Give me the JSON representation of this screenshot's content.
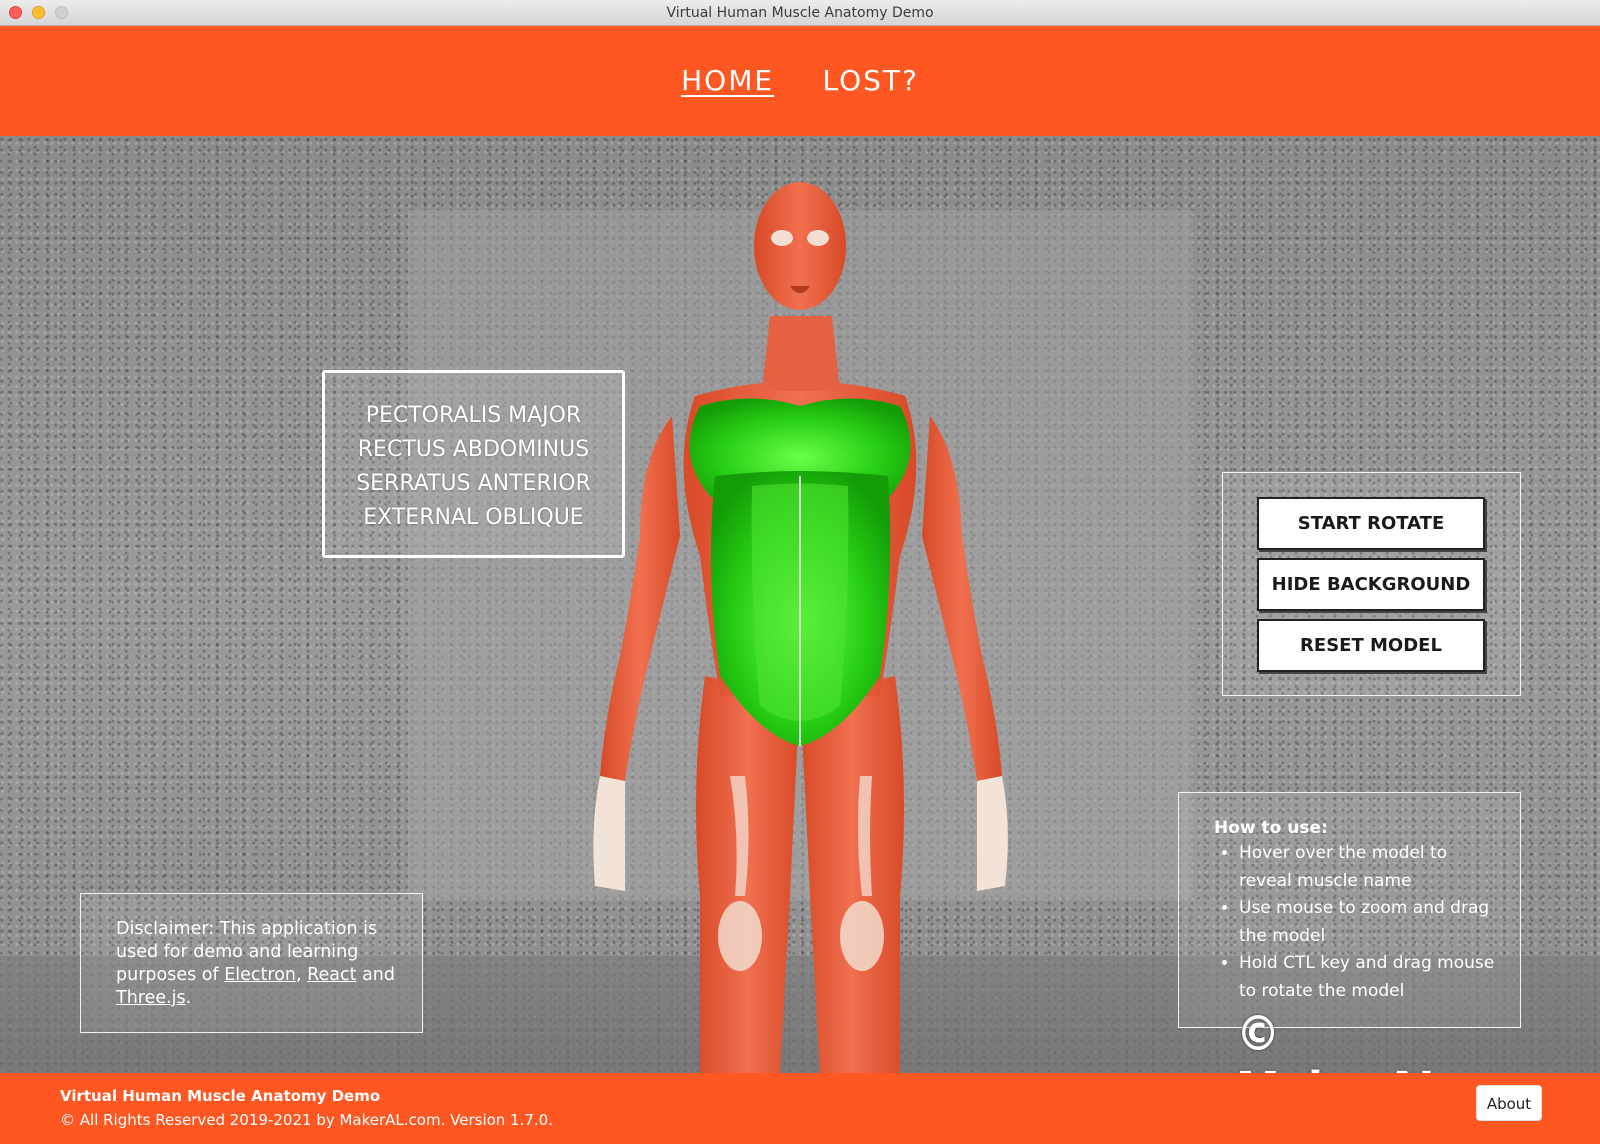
{
  "window": {
    "title": "Virtual Human Muscle Anatomy Demo"
  },
  "nav": {
    "items": [
      {
        "label": "HOME",
        "active": true
      },
      {
        "label": "LOST?",
        "active": false
      }
    ]
  },
  "muscle_list": {
    "items": [
      "PECTORALIS MAJOR",
      "RECTUS ABDOMINUS",
      "SERRATUS ANTERIOR",
      "EXTERNAL OBLIQUE"
    ]
  },
  "controls": {
    "start_rotate": "START ROTATE",
    "hide_background": "HIDE BACKGROUND",
    "reset_model": "RESET MODEL"
  },
  "howto": {
    "title": "How to use:",
    "items": [
      "Hover over the model to reveal muscle name",
      "Use mouse to zoom and drag the model",
      "Hold CTL key and drag mouse to rotate the model"
    ]
  },
  "disclaimer": {
    "prefix": "Disclaimer: This application is used for demo and learning purposes of ",
    "link1": "Electron",
    "sep1": ", ",
    "link2": "React",
    "sep2": " and ",
    "link3": "Three.js",
    "suffix": "."
  },
  "watermark": "© MakerAL.com",
  "footer": {
    "title": "Virtual Human Muscle Anatomy Demo",
    "copyright": "© All Rights Reserved 2019-2021 by MakerAL.com. Version 1.7.0.",
    "about": "About"
  },
  "colors": {
    "accent": "#ff5722",
    "highlight_muscle": "#22c41a",
    "muscle": "#e8603c"
  }
}
